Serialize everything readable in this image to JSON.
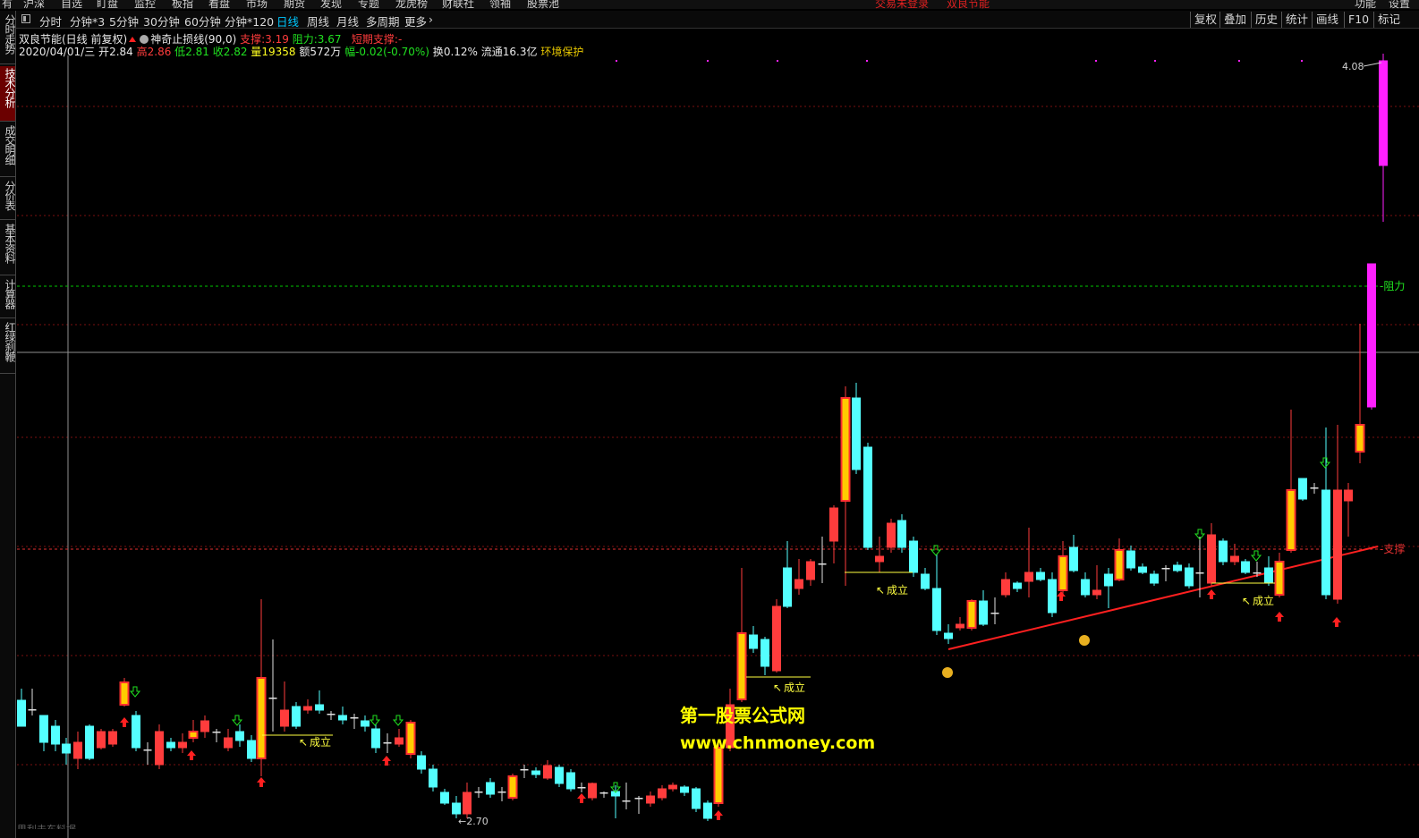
{
  "topmenu": {
    "items": [
      "有",
      "沪深",
      "自选",
      "盯盘",
      "监控",
      "板指",
      "看盘",
      "市场",
      "期货",
      "发现",
      "专题",
      "龙虎榜",
      "财联社",
      "领袖",
      "股票池"
    ],
    "center": [
      "交易未登录",
      "双良节能"
    ],
    "right": [
      "功能",
      "设置"
    ]
  },
  "toolbar": {
    "periods": [
      "分时",
      "分钟*3",
      "5分钟",
      "30分钟",
      "60分钟",
      "分钟*120",
      "日线",
      "周线",
      "月线",
      "多周期",
      "更多"
    ],
    "active_period": "日线",
    "tools": [
      "复权",
      "叠加",
      "历史",
      "统计",
      "画线",
      "F10",
      "标记"
    ]
  },
  "sidetabs": [
    "分时走势",
    "技术分析",
    "成交明细",
    "分价表",
    "基本资料",
    "计算器",
    "红绿刹鞭"
  ],
  "sidetab_active": "技术分析",
  "stock": {
    "name": "双良节能(日线 前复权)",
    "indicator": "神奇止损线(90,0)",
    "support_label": "支撑:",
    "support_value": "3.19",
    "resistance_label": "阻力:",
    "resistance_value": "3.67",
    "short_support": "短期支撑:",
    "short_support_value": "-",
    "date": "2020/04/01/三",
    "open_label": "开",
    "open": "2.84",
    "high_label": "高",
    "high": "2.86",
    "low_label": "低",
    "low": "2.81",
    "close_label": "收",
    "close": "2.82",
    "vol_label": "量",
    "volume": "19358",
    "amt_label": "额",
    "amount": "572万",
    "chg_label": "幅",
    "change": "-0.02(-0.70%)",
    "turn_label": "换",
    "turnover": "0.12%",
    "float_label": "流通",
    "float_cap": "16.3亿",
    "concept": "环境保护"
  },
  "chart": {
    "label_resistance": "阻力",
    "label_support": "支撑",
    "high_marker": "4.08",
    "low_marker": "2.70",
    "established": "成立",
    "colors": {
      "up": "#ff3c3c",
      "down": "#54ffff",
      "signal": "#ffcc00",
      "resistance": "#00c800",
      "support": "#e03030",
      "magenta": "#ff20ff"
    }
  },
  "watermark": {
    "line1": "第一股票公式网",
    "line2": "www.chnmoney.com"
  },
  "footer": "思利去东料据"
}
